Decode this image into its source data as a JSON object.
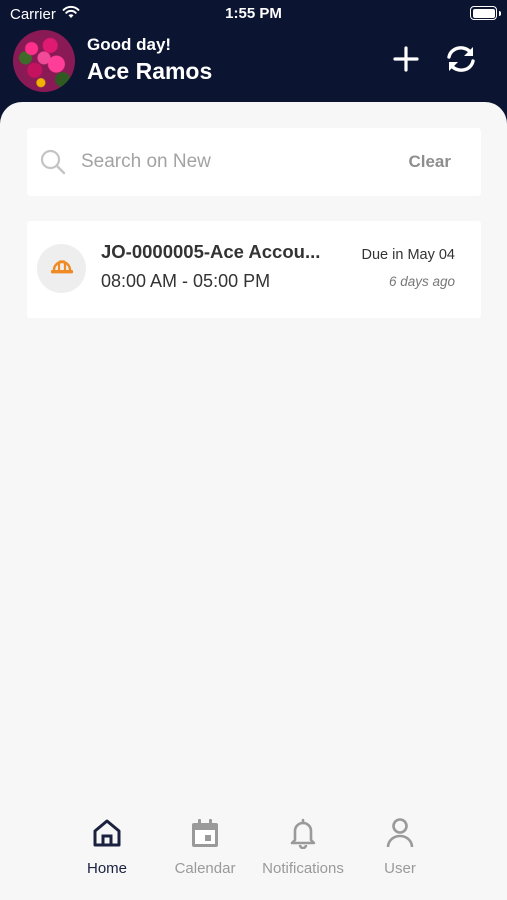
{
  "status_bar": {
    "carrier": "Carrier",
    "time": "1:55 PM"
  },
  "header": {
    "greeting": "Good day!",
    "user_name": "Ace Ramos"
  },
  "search": {
    "placeholder": "Search on New",
    "value": "",
    "clear_label": "Clear"
  },
  "jobs": [
    {
      "title": "JO-0000005-Ace Accou...",
      "time_range": "08:00 AM - 05:00 PM",
      "due": "Due in May 04",
      "ago": "6 days ago",
      "icon": "hard-hat-icon"
    }
  ],
  "tabs": [
    {
      "label": "Home",
      "icon": "home-icon",
      "active": true
    },
    {
      "label": "Calendar",
      "icon": "calendar-icon",
      "active": false
    },
    {
      "label": "Notifications",
      "icon": "bell-icon",
      "active": false
    },
    {
      "label": "User",
      "icon": "user-icon",
      "active": false
    }
  ],
  "colors": {
    "header_bg": "#0b1430",
    "content_bg": "#f7f7f7",
    "accent_orange": "#f08a24",
    "active_tab": "#1b2240",
    "inactive_tab": "#9a9a9a"
  }
}
